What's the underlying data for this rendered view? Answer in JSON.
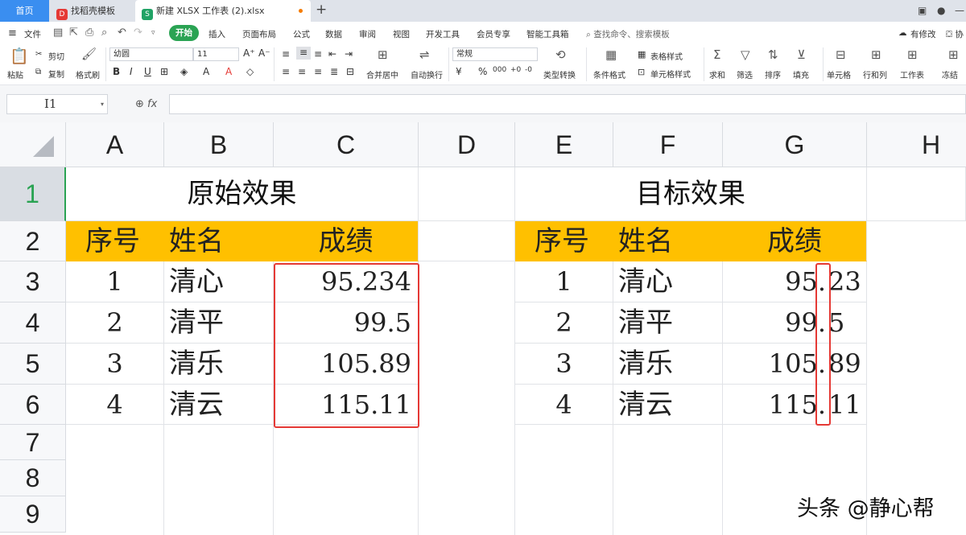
{
  "tabs": {
    "home": "首页",
    "template": "找稻壳模板",
    "active_file": "新建 XLSX 工作表 (2).xlsx",
    "new_tab": "+"
  },
  "menu": {
    "file": "文件",
    "items": [
      "开始",
      "插入",
      "页面布局",
      "公式",
      "数据",
      "审阅",
      "视图",
      "开发工具",
      "会员专享",
      "智能工具箱"
    ],
    "search_placeholder": "查找命令、搜索模板",
    "has_changes": "有修改",
    "collab": "协"
  },
  "ribbon": {
    "paste": "粘贴",
    "cut": "剪切",
    "copy": "复制",
    "format_painter": "格式刷",
    "font_name": "幼圆",
    "font_size": "11",
    "number_format": "常规",
    "merge_center": "合并居中",
    "auto_wrap": "自动换行",
    "type_convert": "类型转换",
    "conditional_format": "条件格式",
    "table_style": "表格样式",
    "cell_style": "单元格样式",
    "sum": "求和",
    "filter": "筛选",
    "sort": "排序",
    "fill": "填充",
    "cell": "单元格",
    "row_col": "行和列",
    "worksheet": "工作表",
    "freeze": "冻结"
  },
  "formula_bar": {
    "name_box": "I1",
    "fx": "fx",
    "formula": ""
  },
  "sheet": {
    "columns": [
      "A",
      "B",
      "C",
      "D",
      "E",
      "F",
      "G",
      "H"
    ],
    "rows": [
      "1",
      "2",
      "3",
      "4",
      "5",
      "6",
      "7",
      "8",
      "9"
    ],
    "left_title": "原始效果",
    "right_title": "目标效果",
    "headers": [
      "序号",
      "姓名",
      "成绩"
    ],
    "left_rows": [
      {
        "no": "1",
        "name": "清心",
        "score": "95.234"
      },
      {
        "no": "2",
        "name": "清平",
        "score": "99.5"
      },
      {
        "no": "3",
        "name": "清乐",
        "score": "105.89"
      },
      {
        "no": "4",
        "name": "清云",
        "score": "115.11"
      }
    ],
    "right_rows": [
      {
        "no": "1",
        "name": "清心",
        "score_int": "95.",
        "score_dec": "23"
      },
      {
        "no": "2",
        "name": "清平",
        "score_int": "99.",
        "score_dec": "5"
      },
      {
        "no": "3",
        "name": "清乐",
        "score_int": "105.",
        "score_dec": "89"
      },
      {
        "no": "4",
        "name": "清云",
        "score_int": "115.",
        "score_dec": "11"
      }
    ],
    "header_color": "#ffc000",
    "highlight_color": "#e53935"
  },
  "watermark": "头条 @静心帮"
}
